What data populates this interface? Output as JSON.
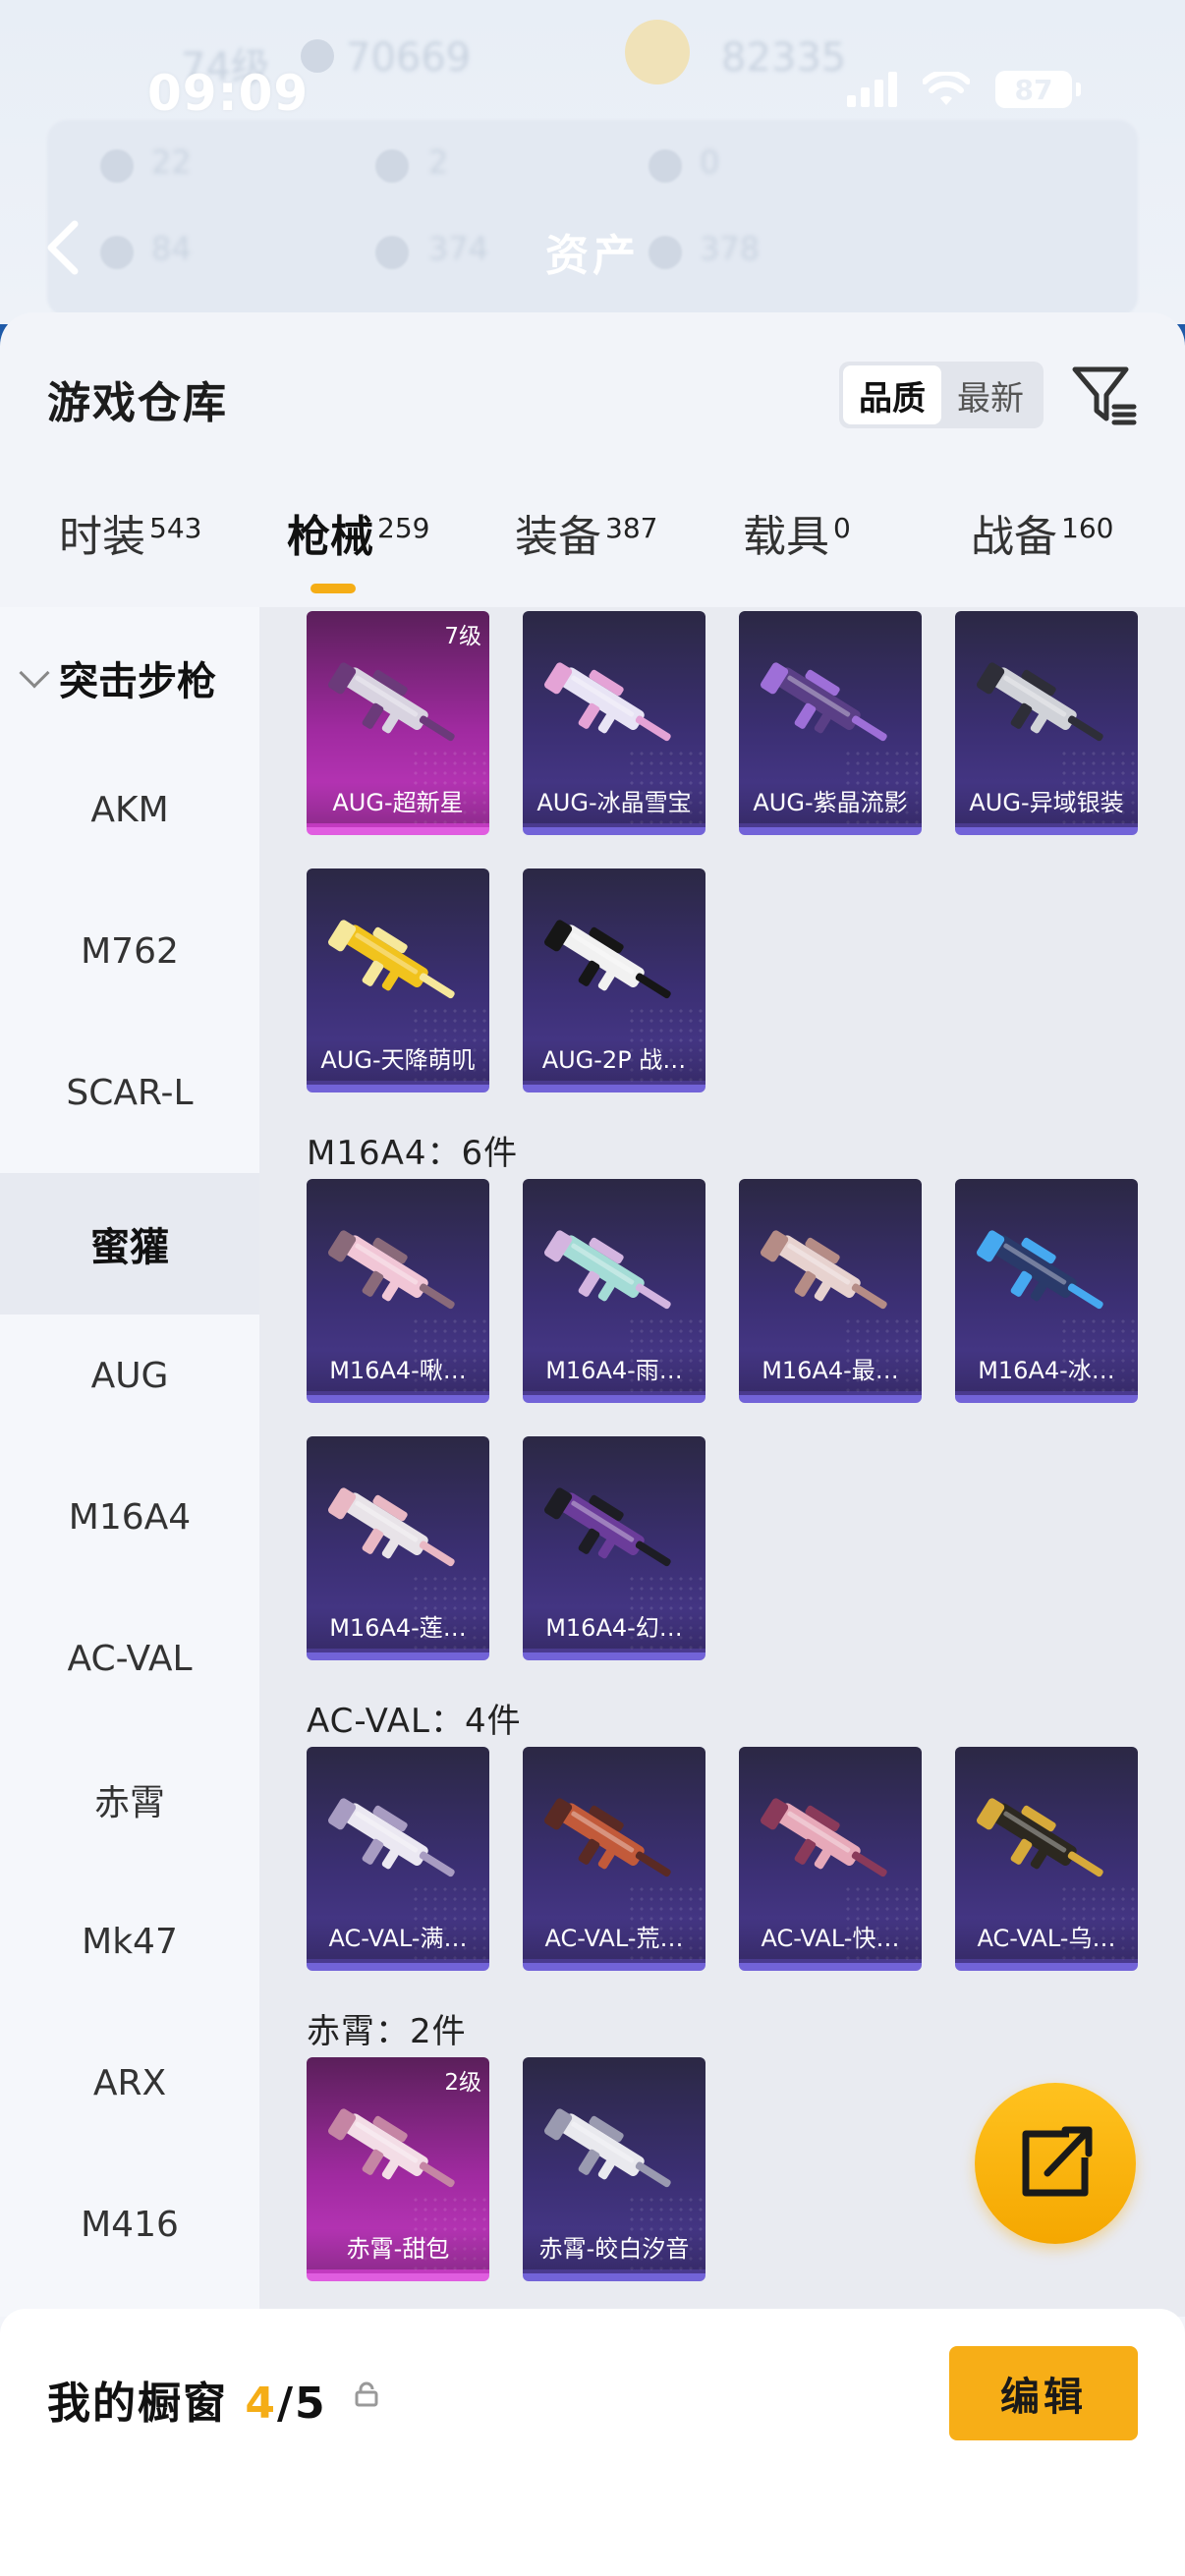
{
  "status_bar": {
    "time": "09:09",
    "battery": "87"
  },
  "header": {
    "title": "资产",
    "back_label": "‹",
    "background": {
      "level": "74级",
      "coins_a": "70669",
      "coins_b": "82335",
      "stats_row1": [
        "22",
        "2",
        "0"
      ],
      "stats_row2": [
        "84",
        "374",
        "378"
      ]
    }
  },
  "warehouse": {
    "title": "游戏仓库",
    "sort_options": [
      {
        "label": "品质",
        "active": true
      },
      {
        "label": "最新",
        "active": false
      }
    ],
    "filter_icon": "filter-icon"
  },
  "tabs": [
    {
      "label": "时装",
      "count": "543",
      "active": false
    },
    {
      "label": "枪械",
      "count": "259",
      "active": true
    },
    {
      "label": "装备",
      "count": "387",
      "active": false
    },
    {
      "label": "载具",
      "count": "0",
      "active": false
    },
    {
      "label": "战备",
      "count": "160",
      "active": false
    }
  ],
  "sidebar": {
    "group": "突击步枪",
    "items": [
      "AKM",
      "M762",
      "SCAR-L",
      "蜜獾",
      "AUG",
      "M16A4",
      "AC-VAL",
      "赤霄",
      "Mk47",
      "ARX",
      "M416"
    ],
    "active_item": "蜜獾"
  },
  "sections": [
    {
      "header": "",
      "items": [
        {
          "name": "AUG-超新星",
          "level": "7级",
          "rarity": "pink",
          "gun": "#d8d3e0",
          "accent": "#6b3a7a"
        },
        {
          "name": "AUG-冰晶雪宝",
          "level": "",
          "rarity": "purple",
          "gun": "#e8e4f5",
          "accent": "#e4a3d6"
        },
        {
          "name": "AUG-紫晶流影",
          "level": "",
          "rarity": "purple",
          "gun": "#5a3f86",
          "accent": "#9e6fd8"
        },
        {
          "name": "AUG-异域银装",
          "level": "",
          "rarity": "purple",
          "gun": "#d0d2d8",
          "accent": "#2e2e38"
        },
        {
          "name": "AUG-天降萌叽",
          "level": "",
          "rarity": "purple",
          "gun": "#f1c31d",
          "accent": "#f6e89b"
        },
        {
          "name": "AUG-2P 战…",
          "level": "",
          "rarity": "purple",
          "gun": "#f1f1f1",
          "accent": "#161616"
        }
      ]
    },
    {
      "header": "M16A4：6件",
      "items": [
        {
          "name": "M16A4-啾…",
          "level": "",
          "rarity": "purple",
          "gun": "#f1c6d6",
          "accent": "#8a6a7a"
        },
        {
          "name": "M16A4-雨…",
          "level": "",
          "rarity": "purple",
          "gun": "#a4dcd6",
          "accent": "#d4b5e0"
        },
        {
          "name": "M16A4-最…",
          "level": "",
          "rarity": "purple",
          "gun": "#e7d2cf",
          "accent": "#b58c86"
        },
        {
          "name": "M16A4-冰…",
          "level": "",
          "rarity": "purple",
          "gun": "#2a3a6a",
          "accent": "#46a9f0"
        },
        {
          "name": "M16A4-莲…",
          "level": "",
          "rarity": "purple",
          "gun": "#e8e3e8",
          "accent": "#e9b8c4"
        },
        {
          "name": "M16A4-幻…",
          "level": "",
          "rarity": "purple",
          "gun": "#6b3c9a",
          "accent": "#1d1d24"
        }
      ]
    },
    {
      "header": "AC-VAL：4件",
      "items": [
        {
          "name": "AC-VAL-满…",
          "level": "",
          "rarity": "purple",
          "gun": "#ebe8f2",
          "accent": "#a89cc2"
        },
        {
          "name": "AC-VAL-荒…",
          "level": "",
          "rarity": "purple",
          "gun": "#c25a3a",
          "accent": "#5a2a24"
        },
        {
          "name": "AC-VAL-快…",
          "level": "",
          "rarity": "purple",
          "gun": "#e7a9b9",
          "accent": "#8a3a5a"
        },
        {
          "name": "AC-VAL-乌…",
          "level": "",
          "rarity": "purple",
          "gun": "#2c2820",
          "accent": "#d7aa3a"
        }
      ]
    },
    {
      "header": "赤霄：2件",
      "items": [
        {
          "name": "赤霄-甜包",
          "level": "2级",
          "rarity": "pink",
          "gun": "#f3dde6",
          "accent": "#c585a4"
        },
        {
          "name": "赤霄-皎白汐音",
          "level": "",
          "rarity": "purple",
          "gun": "#e9e9ee",
          "accent": "#9a9ab0"
        }
      ]
    }
  ],
  "showcase": {
    "label": "我的橱窗",
    "filled": "4",
    "separator": "/",
    "total": "5",
    "edit_label": "编辑"
  },
  "colors": {
    "accent": "#f5ad16",
    "card_purple": "#3b2f73",
    "card_pink": "#a02aa0"
  }
}
